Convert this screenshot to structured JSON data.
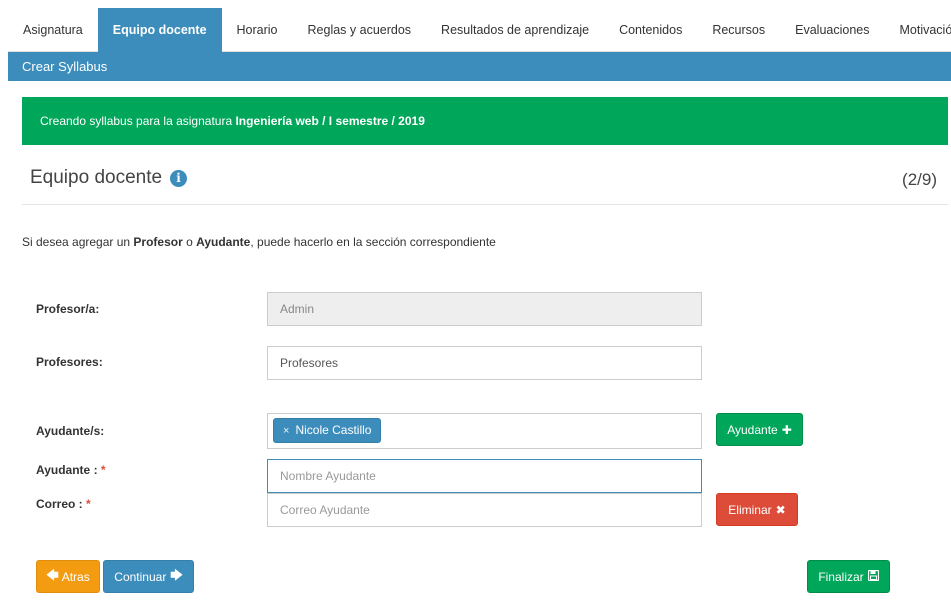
{
  "tabs": [
    {
      "label": "Asignatura"
    },
    {
      "label": "Equipo docente",
      "active": true
    },
    {
      "label": "Horario"
    },
    {
      "label": "Reglas y acuerdos"
    },
    {
      "label": "Resultados de aprendizaje"
    },
    {
      "label": "Contenidos"
    },
    {
      "label": "Recursos"
    },
    {
      "label": "Evaluaciones"
    },
    {
      "label": "Motivación"
    }
  ],
  "header": {
    "title": "Crear Syllabus"
  },
  "alert": {
    "prefix": "Creando syllabus para la asignatura ",
    "course": "Ingeniería web / I semestre / 2019"
  },
  "section": {
    "title": "Equipo docente",
    "step": "(2/9)",
    "icon": "info-icon"
  },
  "hint": {
    "part1": "Si desea agregar un ",
    "profesor": "Profesor",
    "part2": " o ",
    "ayudante": "Ayudante",
    "part3": ", puede hacerlo en la sección correspondiente"
  },
  "form": {
    "profesor_label": "Profesor/a:",
    "profesor_value": "Admin",
    "profesores_label": "Profesores:",
    "profesores_value": "Profesores",
    "ayudantes_label": "Ayudante/s:",
    "ayudante_tag": "Nicole Castillo",
    "ayudante_tag_remove": "×",
    "add_ayudante_button": "Ayudante",
    "ayudante_label": "Ayudante :",
    "ayudante_placeholder": "Nombre Ayudante",
    "correo_label": "Correo :",
    "correo_placeholder": "Correo Ayudante",
    "required_mark": "*",
    "delete_button": "Eliminar"
  },
  "actions": {
    "back_button": "Atras",
    "continue_button": "Continuar",
    "finish_button": "Finalizar"
  },
  "colors": {
    "primary": "#3c8dbc",
    "success": "#00a65a",
    "danger": "#dd4b39",
    "warning": "#f39c12"
  }
}
